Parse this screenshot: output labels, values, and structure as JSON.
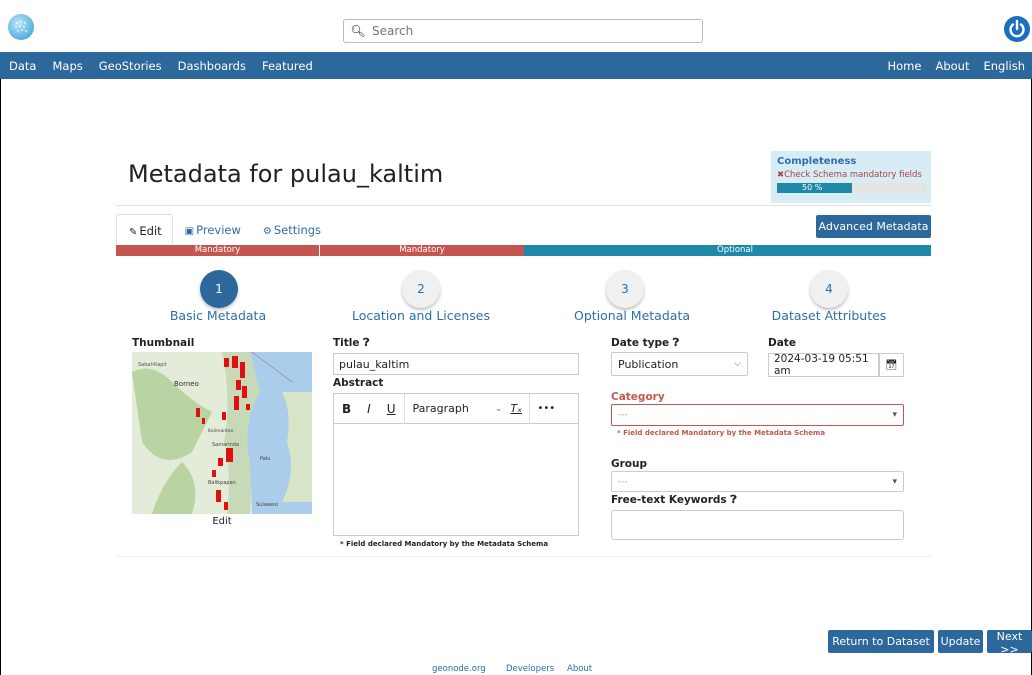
{
  "header": {
    "logo_icon": "geonode-logo-icon",
    "search_placeholder": "Search",
    "power_icon": "power-icon"
  },
  "navbar": {
    "left_items": [
      "Data",
      "Maps",
      "GeoStories",
      "Dashboards",
      "Featured"
    ],
    "right_items": [
      "Home",
      "About",
      "English"
    ]
  },
  "page": {
    "title": "Metadata for pulau_kaltim"
  },
  "completeness": {
    "title": "Completeness",
    "warning": "Check Schema mandatory fields",
    "percent_label": "50 %",
    "percent": 50
  },
  "tabs": [
    {
      "label": "Edit",
      "icon": "pencil-icon"
    },
    {
      "label": "Preview",
      "icon": "camera-icon"
    },
    {
      "label": "Settings",
      "icon": "gear-icon"
    }
  ],
  "advanced_button": "Advanced Metadata",
  "strip": [
    "Mandatory",
    "Mandatory",
    "Optional"
  ],
  "steps": [
    {
      "number": "1",
      "label": "Basic Metadata"
    },
    {
      "number": "2",
      "label": "Location and Licenses"
    },
    {
      "number": "3",
      "label": "Optional Metadata"
    },
    {
      "number": "4",
      "label": "Dataset Attributes"
    }
  ],
  "form": {
    "thumbnail_label": "Thumbnail",
    "thumbnail_edit": "Edit",
    "title_label": "Title",
    "title_value": "pulau_kaltim",
    "abstract_label": "Abstract",
    "editor_toolbar": {
      "bold": "B",
      "italic": "I",
      "underline": "U",
      "block": "Paragraph",
      "more": "•••"
    },
    "abstract_note": "* Field declared Mandatory by the Metadata Schema",
    "date_type_label": "Date type",
    "date_type_value": "Publication",
    "date_label": "Date",
    "date_value": "2024-03-19 05:51 am",
    "category_label": "Category",
    "category_value": "---",
    "category_note": "* Field declared Mandatory by the Metadata Schema",
    "group_label": "Group",
    "group_value": "---",
    "keywords_label": "Free-text Keywords"
  },
  "map_labels": [
    "Sabah",
    "Kapit",
    "Borneo",
    "Kalimantan",
    "Samarinda",
    "Palu",
    "Balikpapan",
    "Sulawesi"
  ],
  "buttons": {
    "return": "Return to Dataset",
    "update": "Update",
    "next": "Next >>"
  },
  "footer": [
    "geonode.org",
    "Developers",
    "About"
  ]
}
